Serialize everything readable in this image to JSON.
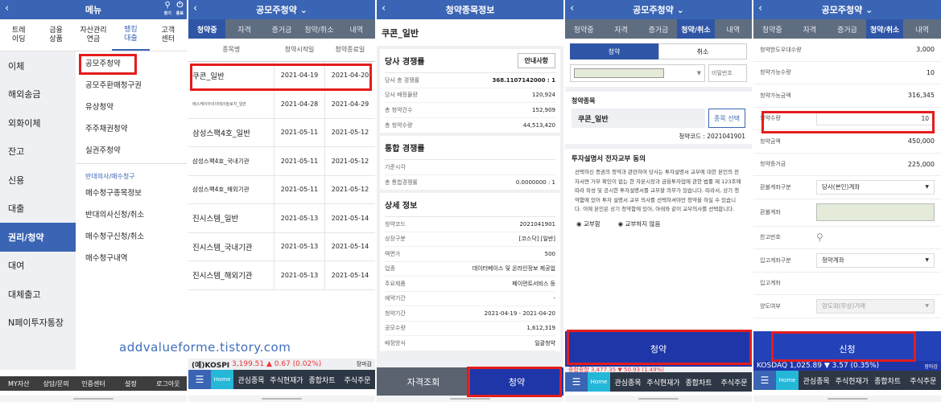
{
  "watermark": "addvalueforme.tistory.com",
  "p1": {
    "title": "메뉴",
    "icons": [
      {
        "name": "search-icon",
        "glyph": "⚲",
        "label": "찾기"
      },
      {
        "name": "power-icon",
        "glyph": "⏻",
        "label": "종료"
      }
    ],
    "categories": [
      "트레\n이딩",
      "금융\n상품",
      "자산관리\n연금",
      "뱅킹\n대출",
      "고객\n센터"
    ],
    "left_items": [
      "이체",
      "해외송금",
      "외화이체",
      "잔고",
      "신용",
      "대출",
      "권리/청약",
      "대여",
      "대체출고",
      "N페이투자통장"
    ],
    "right_items": [
      "공모주청약",
      "공모주환매청구권",
      "유상청약",
      "주주채권청약",
      "실권주청약"
    ],
    "right_section": "반대의사/매수청구",
    "right_items2": [
      "매수청구종목정보",
      "반대의사신청/취소",
      "매수청구신청/취소",
      "매수청구내역"
    ],
    "bottom": [
      "MY자산",
      "상담/문의",
      "인증센터",
      "설정",
      "로그아웃"
    ]
  },
  "p2": {
    "title": "공모주청약 ⌄",
    "tabs": [
      "청약중",
      "자격",
      "증거금",
      "청약/취소",
      "내역"
    ],
    "headers": [
      "종목명",
      "청약시작일",
      "청약종료일"
    ],
    "rows": [
      {
        "name": "쿠콘_일반",
        "start": "2021-04-19",
        "end": "2021-04-20"
      },
      {
        "name": "에스케이아이이테크놀로지_일반",
        "start": "2021-04-28",
        "end": "2021-04-29"
      },
      {
        "name": "삼성스팩4호_일반",
        "start": "2021-05-11",
        "end": "2021-05-12"
      },
      {
        "name": "삼성스팩4호_국내기관",
        "start": "2021-05-11",
        "end": "2021-05-12"
      },
      {
        "name": "삼성스팩4호_해외기관",
        "start": "2021-05-11",
        "end": "2021-05-12"
      },
      {
        "name": "진시스템_일반",
        "start": "2021-05-13",
        "end": "2021-05-14"
      },
      {
        "name": "진시스템_국내기관",
        "start": "2021-05-13",
        "end": "2021-05-14"
      },
      {
        "name": "진시스템_해외기관",
        "start": "2021-05-13",
        "end": "2021-05-14"
      }
    ],
    "ticker": {
      "label": "(예)KOSPI",
      "value": "3,199.51",
      "change": "▲ 0.67 (0.02%)",
      "status": "장마감"
    }
  },
  "p3": {
    "title": "청약종목정보",
    "stock": "쿠콘_일반",
    "comp_title": "당사 경쟁률",
    "guide_btn": "안내사항",
    "comp_rows": [
      {
        "k": "당사 총 경쟁률",
        "v": "368.1107142000  :  1"
      },
      {
        "k": "당사 배정물량",
        "v": "120,924"
      },
      {
        "k": "총 청약건수",
        "v": "152,909"
      },
      {
        "k": "총 청약수량",
        "v": "44,513,420"
      }
    ],
    "total_title": "통합 경쟁률",
    "total_rows": [
      {
        "k": "기준시각",
        "v": ""
      },
      {
        "k": "총 통합경쟁률",
        "v": "0.0000000  :  1"
      }
    ],
    "detail_title": "상세 정보",
    "detail_rows": [
      {
        "k": "청약코드",
        "v": "2021041901"
      },
      {
        "k": "상장구분",
        "v": "[코스닥] [일반]"
      },
      {
        "k": "액면가",
        "v": "500"
      },
      {
        "k": "업종",
        "v": "데이터베이스 및 온라인정보 제공업"
      },
      {
        "k": "주요제품",
        "v": "페이먼트서비스 등"
      },
      {
        "k": "예약기간",
        "v": "-"
      },
      {
        "k": "청약기간",
        "v": "2021-04-19   -   2021-04-20"
      },
      {
        "k": "공모수량",
        "v": "1,612,319"
      },
      {
        "k": "배정방식",
        "v": "일괄청약"
      }
    ],
    "btn_left": "자격조회",
    "btn_right": "청약"
  },
  "p4": {
    "title": "공모주청약 ⌄",
    "tabs": [
      "청약중",
      "자격",
      "증거금",
      "청약/취소",
      "내역"
    ],
    "seg": [
      "청약",
      "취소"
    ],
    "pw_placeholder": "비밀번호",
    "item_label": "청약종목",
    "item_name": "쿠콘_일반",
    "select_btn": "종목 선택",
    "code_text": "청약코드 : 2021041901",
    "consent_title": "투자설명서 전자교부 동의",
    "consent_body": "선택하신 증권의 청약과 관련하여 당사는 투자설명서 교부에 대한 본인의 전자서면 거부 확인이 없는 한 자본시장과 금융투자업에 관한 법률 제 123조에 따라 작성 및 공시한 투자설명서를 교부할 의무가 있습니다. 따라서, 상기 청약함에 있어 투자 설명서 교부 의사를 선택하셔야만 청약을 하실 수 있습니다. 이에 본인은 상기 청약함에 있어, 아래와 같이 교부의사를 선택합니다.",
    "radio1": "교부함",
    "radio2": "교부하지 않음",
    "action": "청약",
    "ticker": "종합종합  3,477.35  ▼ 50.93 (1.49%)",
    "nav": [
      "관심종목",
      "주식현재가",
      "종합차트",
      "주식주문"
    ]
  },
  "p5": {
    "title": "공모주청약 ⌄",
    "tabs": [
      "청약중",
      "자격",
      "증거금",
      "청약/취소",
      "내역"
    ],
    "fields": [
      {
        "k": "청약한도우대수량",
        "v": "3,000"
      },
      {
        "k": "청약가능수량",
        "v": "10"
      },
      {
        "k": "청약가능금액",
        "v": "316,345"
      },
      {
        "k": "청약수량",
        "v": "10"
      },
      {
        "k": "청약금액",
        "v": "450,000"
      },
      {
        "k": "청약증거금",
        "v": "225,000"
      }
    ],
    "refund_type_k": "환불계좌구분",
    "refund_type_v": "당사(본인)계좌",
    "refund_acct_k": "환불계좌",
    "bank_k": "찬고번호",
    "deposit_type_k": "입고계좌구분",
    "deposit_type_v": "청약계좌",
    "deposit_acct_k": "입고계좌",
    "transfer_k": "양도여부",
    "transfer_v": "양도외(무상)거래",
    "action": "신청",
    "ticker": "KOSDAQ  1,025.89  ▼ 3.57 (0.35%)",
    "ticker_status": "장마감",
    "nav": [
      "관심종목",
      "주식현재가",
      "종합차트",
      "주식주문"
    ]
  },
  "nav_menu": "메뉴",
  "nav_home": "Home",
  "colors": {
    "primary": "#3a64b4",
    "action": "#1f36a8",
    "highlight": "#e41c1c"
  }
}
